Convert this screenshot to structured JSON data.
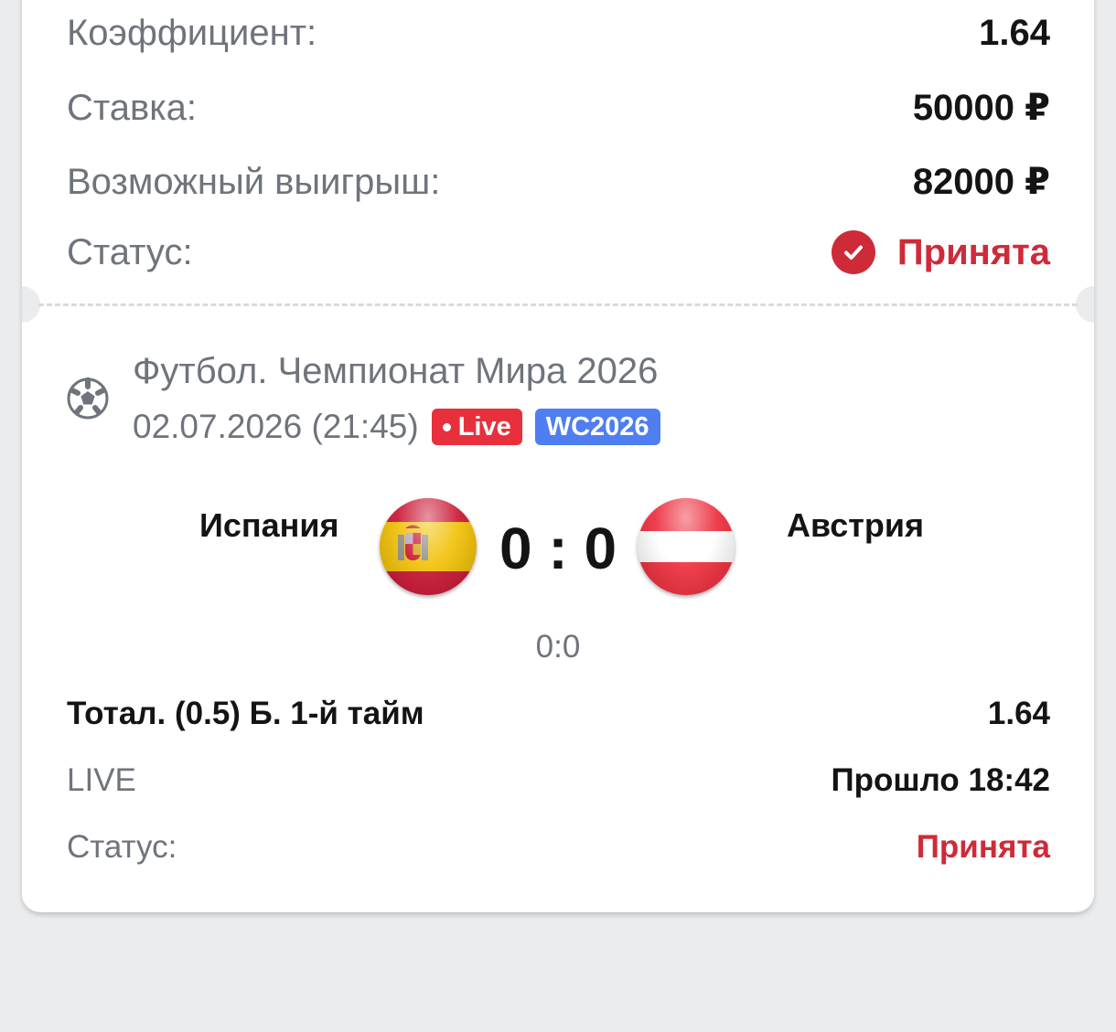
{
  "summary": {
    "coefficient_label": "Коэффициент:",
    "coefficient_value": "1.64",
    "stake_label": "Ставка:",
    "stake_value": "50000 ₽",
    "payout_label": "Возможный выигрыш:",
    "payout_value": "82000 ₽",
    "status_label": "Статус:",
    "status_value": "Принята"
  },
  "event": {
    "title": "Футбол. Чемпионат Мира 2026",
    "date": "02.07.2026 (21:45)",
    "badges": {
      "live": "Live",
      "tournament": "WC2026"
    },
    "sport_icon": "soccer-ball-icon",
    "home_team": "Испания",
    "away_team": "Австрия",
    "home_flag": "spain-flag-icon",
    "away_flag": "austria-flag-icon",
    "score": "0 : 0",
    "half_score": "0:0"
  },
  "bet": {
    "market": "Тотал. (0.5) Б. 1-й тайм",
    "odds": "1.64",
    "mode": "LIVE",
    "elapsed": "Прошло 18:42",
    "status_label": "Статус:",
    "status_value": "Принята"
  },
  "colors": {
    "accent_red": "#cf2a38",
    "live_badge": "#e8303c",
    "tournament_badge": "#4f7ef0",
    "page_bg": "#ebecee"
  }
}
